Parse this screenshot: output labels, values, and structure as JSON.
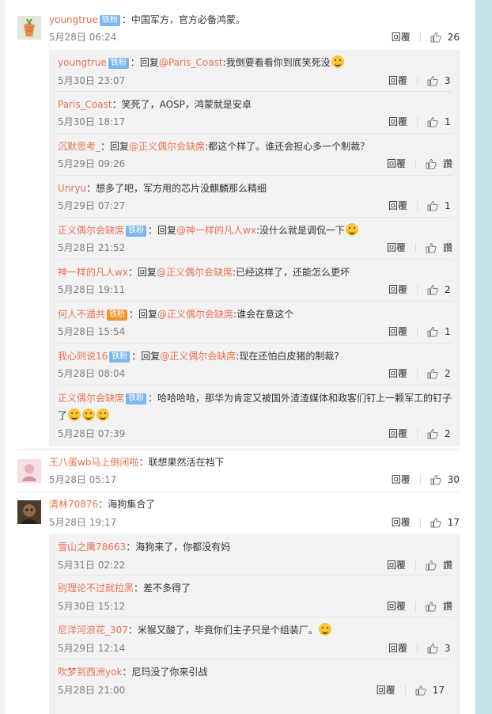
{
  "ui": {
    "reply_label": "回覆",
    "zan_label": "讚"
  },
  "comments": [
    {
      "user": "youngtrue",
      "badge": "铁粉",
      "text": "：中国军方，官方必备鸿蒙。",
      "time": "5月28日 06:24",
      "likes": "26",
      "replies": [
        {
          "user": "youngtrue",
          "badge": "铁粉",
          "prefix": "：回复",
          "mention": "@Paris_Coast",
          "text": ":我倒要看看你到底笑死没",
          "emoji": 1,
          "time": "5月30日 23:07",
          "likes": "3"
        },
        {
          "user": "Paris_Coast",
          "text": "：笑死了，AOSP，鸿蒙就是安卓",
          "time": "5月30日 18:17",
          "likes": "1"
        },
        {
          "user": "沉默思考_",
          "prefix": "：回复",
          "mention": "@正义偶尔会缺席",
          "text": ":都这个样了。谁还会担心多一个制裁？",
          "time": "5月29日 09:26",
          "likes": "讚"
        },
        {
          "user": "Unryu",
          "text": "：想多了吧，军方用的芯片没麒麟那么精细",
          "time": "5月29日 07:27",
          "likes": "1"
        },
        {
          "user": "正义偶尔会缺席",
          "badge": "铁粉",
          "prefix": "：回复",
          "mention": "@神一样的凡人wx",
          "text": ":没什么就是调侃一下",
          "emoji": 1,
          "time": "5月28日 21:52",
          "likes": "讚"
        },
        {
          "user": "神一样的凡人wx",
          "prefix": "：回复",
          "mention": "@正义偶尔会缺席",
          "text": ":已经这样了，还能怎么更坏",
          "time": "5月28日 19:11",
          "likes": "2"
        },
        {
          "user": "何人不遁共",
          "badge_orange": "铁粉",
          "prefix": "：回复",
          "mention": "@正义偶尔会缺席",
          "text": ":谁会在意这个",
          "time": "5月28日 15:54",
          "likes": "1"
        },
        {
          "user": "我心则说16",
          "badge": "铁粉",
          "prefix": "：回复",
          "mention": "@正义偶尔会缺席",
          "text": ":现在还怕白皮猪的制裁?",
          "time": "5月28日 08:04",
          "likes": "2"
        },
        {
          "user": "正义偶尔会缺席",
          "badge": "铁粉",
          "text": "：哈哈哈哈，那华为肯定又被国外渣渣媒体和政客们钉上一颗军工的钉子了",
          "emoji": 3,
          "time": "5月28日 07:39",
          "likes": "2"
        }
      ]
    },
    {
      "user": "王八蛋wb马上倒闭啦",
      "text": "：联想果然活在裆下",
      "time": "5月28日 05:17",
      "likes": "30",
      "replies": []
    },
    {
      "user": "清林70876",
      "text": "：海狗集合了",
      "time": "5月28日 19:17",
      "likes": "17",
      "replies": [
        {
          "user": "雪山之鹰78663",
          "text": "：海狗来了，你都没有妈",
          "time": "5月31日 02:22",
          "likes": "讚"
        },
        {
          "user": "别理论不过就拉黑",
          "text": "：差不多得了",
          "time": "5月30日 15:12",
          "likes": "讚"
        },
        {
          "user": "尼洋河浪花_307",
          "text": "：米猴又酸了，毕竟你们主子只是个组装厂。",
          "emoji": 1,
          "time": "5月29日 12:14",
          "likes": "3"
        },
        {
          "user": "吹梦到西洲yok",
          "text": "：尼玛没了你来引战",
          "time": "5月28日 21:00",
          "likes": "17"
        }
      ]
    }
  ]
}
